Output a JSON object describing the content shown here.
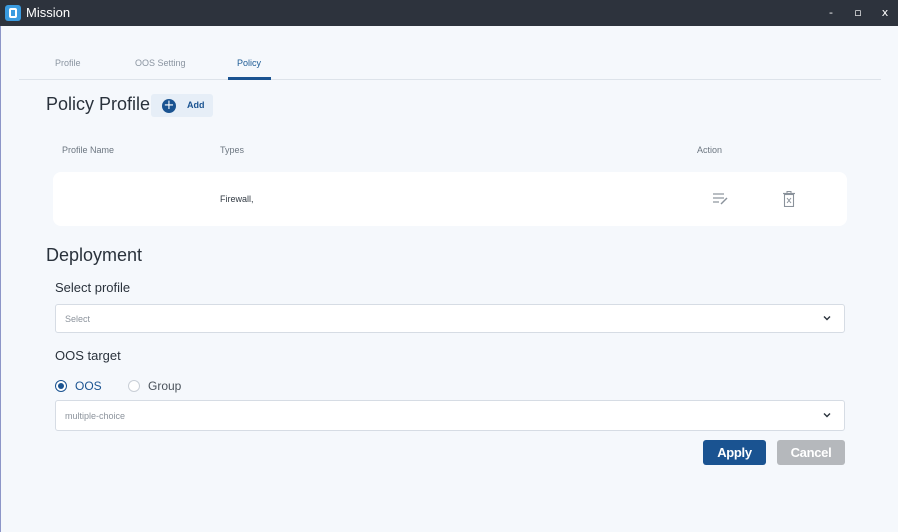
{
  "window": {
    "title": "Mission",
    "minimize_label": "-",
    "maximize_label": "▫",
    "close_label": "x"
  },
  "tabs": [
    {
      "label": "Profile"
    },
    {
      "label": "OOS Setting"
    },
    {
      "label": "Policy",
      "active": true
    }
  ],
  "policy_profile": {
    "heading": "Policy Profile",
    "add_label": "Add",
    "columns": [
      "Profile Name",
      "Types",
      "Action"
    ],
    "rows": [
      {
        "profile_name": "",
        "types": "Firewall,",
        "actions": [
          "edit-icon",
          "delete-icon"
        ]
      }
    ]
  },
  "deployment": {
    "heading": "Deployment",
    "select_profile_label": "Select profile",
    "select_placeholder": "Select",
    "oos_target_label": "OOS target",
    "radio_options": [
      {
        "label": "OOS",
        "checked": true
      },
      {
        "label": "Group",
        "checked": false
      }
    ],
    "multi_placeholder": "multiple-choice",
    "apply_label": "Apply",
    "cancel_label": "Cancel"
  },
  "colors": {
    "titlebar": "#2d333d",
    "accent": "#1a5391",
    "background": "#f5f8fc",
    "cancel_button": "#b5b8bc"
  }
}
